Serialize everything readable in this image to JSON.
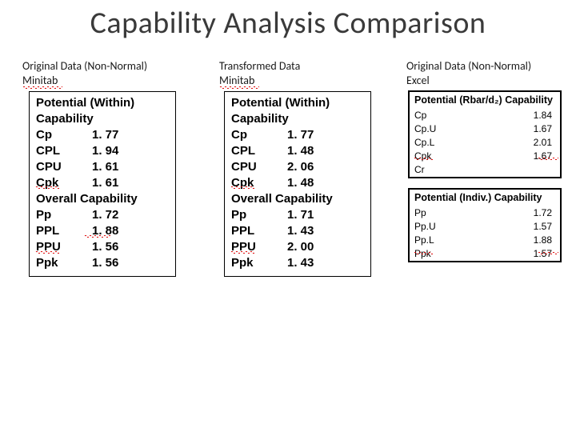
{
  "title": "Capability Analysis Comparison",
  "cols": {
    "c1": {
      "line1": "Original Data (Non-Normal)",
      "line2": "Minitab"
    },
    "c2": {
      "line1": "Transformed Data",
      "line2": "Minitab"
    },
    "c3": {
      "line1": "Original Data (Non-Normal)",
      "line2": "Excel"
    }
  },
  "box1": {
    "h1a": "Potential (Within)",
    "h1b": "Capability",
    "r1k": "Cp",
    "r1v": "1. 77",
    "r2k": "CPL",
    "r2v": "1. 94",
    "r3k": "CPU",
    "r3v": "1. 61",
    "r4k": "Cpk",
    "r4v": "1. 61",
    "h2": "Overall Capability",
    "r5k": "Pp",
    "r5v": "1. 72",
    "r6k": "PPL",
    "r6v": "1. 88",
    "r7k": "PPU",
    "r7v": "1. 56",
    "r8k": "Ppk",
    "r8v": "1. 56"
  },
  "box2": {
    "h1a": "Potential (Within)",
    "h1b": "Capability",
    "r1k": "Cp",
    "r1v": "1. 77",
    "r2k": "CPL",
    "r2v": "1. 48",
    "r3k": "CPU",
    "r3v": "2. 06",
    "r4k": "Cpk",
    "r4v": "1. 48",
    "h2": "Overall Capability",
    "r5k": "Pp",
    "r5v": "1. 71",
    "r6k": "PPL",
    "r6v": "1. 43",
    "r7k": "PPU",
    "r7v": "2. 00",
    "r8k": "Ppk",
    "r8v": "1. 43"
  },
  "excel": {
    "top": {
      "head": "Potential (Rbar/d₂) Capability",
      "r1k": "Cp",
      "r1v": "1.84",
      "r2k": "Cp.U",
      "r2v": "1.67",
      "r3k": "Cp.L",
      "r3v": "2.01",
      "r4k": "Cpk",
      "r4v": "1.67",
      "r5k": "Cr",
      "r5v": ""
    },
    "bot": {
      "head": "Potential (Indiv.) Capability",
      "r1k": "Pp",
      "r1v": "1.72",
      "r2k": "Pp.U",
      "r2v": "1.57",
      "r3k": "Pp.L",
      "r3v": "1.88",
      "r4k": "Ppk",
      "r4v": "1.57"
    }
  }
}
